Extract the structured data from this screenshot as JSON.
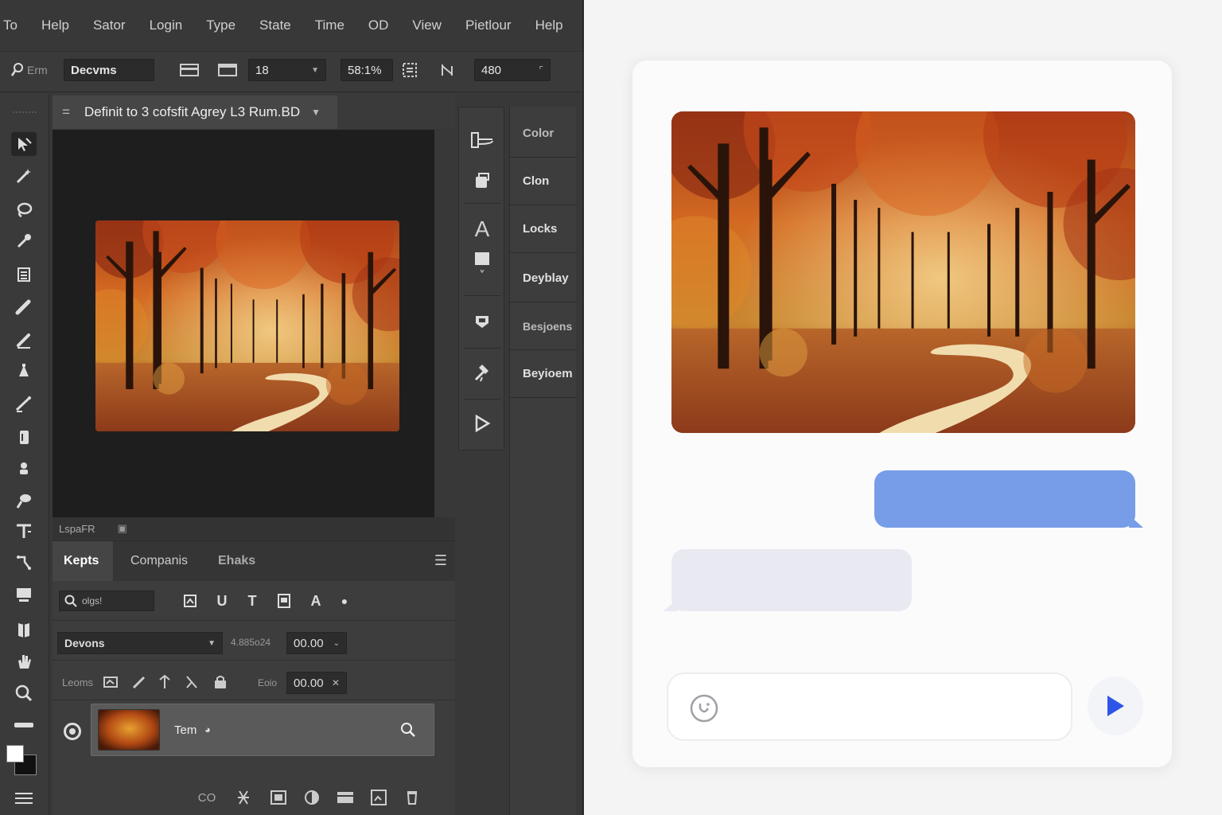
{
  "editor": {
    "menu": [
      "To",
      "Help",
      "Sator",
      "Login",
      "Type",
      "State",
      "Time",
      "OD",
      "View",
      "Pietlour",
      "Help"
    ],
    "options": {
      "tool_hint": "Erm",
      "preset": "Decvms",
      "font_size": "18",
      "zoom": "58:1%",
      "value": "480"
    },
    "document_tab": "Definit to 3 cofsfit Agrey L3 Rum.BD",
    "status_text": "LspaFR",
    "tools": [
      "move-tool",
      "magic-wand-tool",
      "lasso-tool",
      "eyedropper-tool",
      "crop-tool",
      "brush-tool",
      "pencil-tool",
      "bucket-tool",
      "healing-tool",
      "eraser-tool",
      "stamp-tool",
      "smudge-tool",
      "type-tool",
      "path-tool",
      "screen-mode-tool",
      "book-tool",
      "hand-tool",
      "zoom-tool",
      "ruler-tool"
    ],
    "layers_panel": {
      "tabs": [
        "Kepts",
        "Companis",
        "Ehaks"
      ],
      "active_tab": "Kepts",
      "filter_placeholder": "olgs!",
      "blend_mode": "Devons",
      "opacity_label": "4.885o24",
      "opacity_value": "00.00",
      "lock_label": "Leoms",
      "fill_label": "Eoio",
      "fill_value": "00.00",
      "layer_name": "Tem",
      "footer_icons": [
        "link-icon",
        "fx-icon",
        "mask-icon",
        "adjustment-icon",
        "group-icon",
        "new-layer-icon",
        "delete-icon"
      ],
      "footer_link_text": "CO"
    },
    "panels": [
      "Color",
      "Clon",
      "Locks",
      "Deyblay",
      "Besjoens",
      "Beyioem"
    ]
  },
  "chat": {
    "photo_alt": "autumn forest path",
    "composer_placeholder": "",
    "sent_color": "#779de8",
    "received_color": "#e9eaf1",
    "send_icon_color": "#2f55e8"
  }
}
